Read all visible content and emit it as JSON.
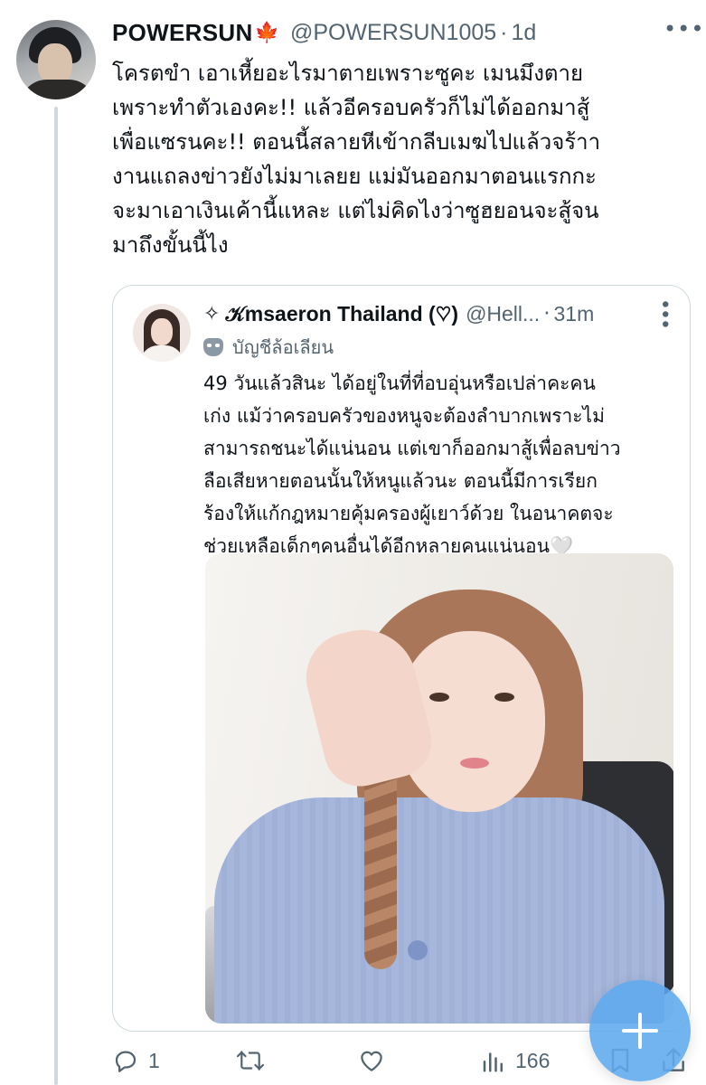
{
  "tweet": {
    "author_name": "POWERSUN",
    "name_emoji": "🍁",
    "handle": "@POWERSUN1005",
    "separator": "·",
    "time": "1d",
    "more_icon": "more-horizontal-icon",
    "text": "โครตขำ เอาเหี้ยอะไรมาตายเพราะซูคะ เมนมึงตาย\nเพราะทำตัวเองคะ!! แล้วอีครอบครัวก็ไม่ได้ออกมาสู้\nเพื่อแซรนคะ!! ตอนนี้สลายหีเข้ากลีบเมฆไปแล้วจร้าา\nงานแถลงข่าวยังไม่มาเลยย แม่มันออกมาตอนแรกกะ\nจะมาเอาเงินเค้านี้แหละ แต่ไม่คิดไงว่าซูฮยอนจะสู้จน\nมาถึงขั้นนี้ไง"
  },
  "quoted": {
    "prefix_symbol": "✧",
    "author_name": "𝒦msaeron Thailand (♡)",
    "handle": "@Hell...",
    "separator": "·",
    "time": "31m",
    "more_icon": "more-vertical-icon",
    "label_icon": "parody-mask-icon",
    "label": "บัญชีล้อเลียน",
    "text": "49 วันแล้วสินะ ได้อยู่ในที่ที่อบอุ่นหรือเปล่าคะคน\nเก่ง แม้ว่าครอบครัวของหนูจะต้องลำบากเพราะไม่\nสามารถชนะได้แน่นอน แต่เขาก็ออกมาสู้เพื่อลบข่าว\nลือเสียหายตอนนั้นให้หนูแล้วนะ ตอนนี้มีการเรียก\nร้องให้แก้กฎหมายคุ้มครองผู้เยาว์ด้วย ในอนาคตจะ\nช่วยเหลือเด็กๆคนอื่นได้อีกหลายคนแน่นอน",
    "heart_glyph": "🤍",
    "photo": "photo-girl-peace-sign"
  },
  "actions": {
    "reply_count": "1",
    "retweet_count": "",
    "like_count": "",
    "views_count": "166"
  },
  "colors": {
    "text": "#0f1419",
    "secondary": "#536471",
    "border": "#cfd9de",
    "fab": "#5faaee"
  }
}
